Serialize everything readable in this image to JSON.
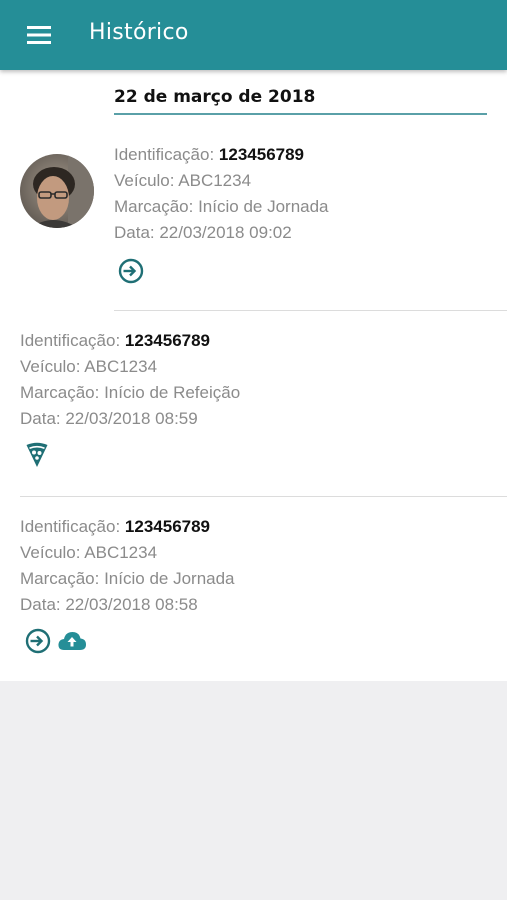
{
  "app": {
    "title": "Histórico",
    "menu_icon": "menu-icon",
    "accent": "#258e97",
    "icon_color": "#1f6f75"
  },
  "history": {
    "date": "22 de março de 2018",
    "records": [
      {
        "id_label": "Identificação:",
        "id_value": "123456789",
        "vehicle": "Veículo: ABC1234",
        "mark": "Marcação: Início de Jornada",
        "date": "Data: 22/03/2018 09:02",
        "icons": [
          "login-icon"
        ],
        "has_photo": true
      },
      {
        "id_label": "Identificação:",
        "id_value": "123456789",
        "vehicle": "Veículo: ABC1234",
        "mark": "Marcação: Início de Refeição",
        "date": "Data: 22/03/2018 08:59",
        "icons": [
          "pizza-icon"
        ],
        "has_photo": false
      },
      {
        "id_label": "Identificação:",
        "id_value": "123456789",
        "vehicle": "Veículo: ABC1234",
        "mark": "Marcação: Início de Jornada",
        "date": "Data: 22/03/2018 08:58",
        "icons": [
          "login-icon",
          "cloud-upload-icon"
        ],
        "has_photo": false
      }
    ]
  }
}
